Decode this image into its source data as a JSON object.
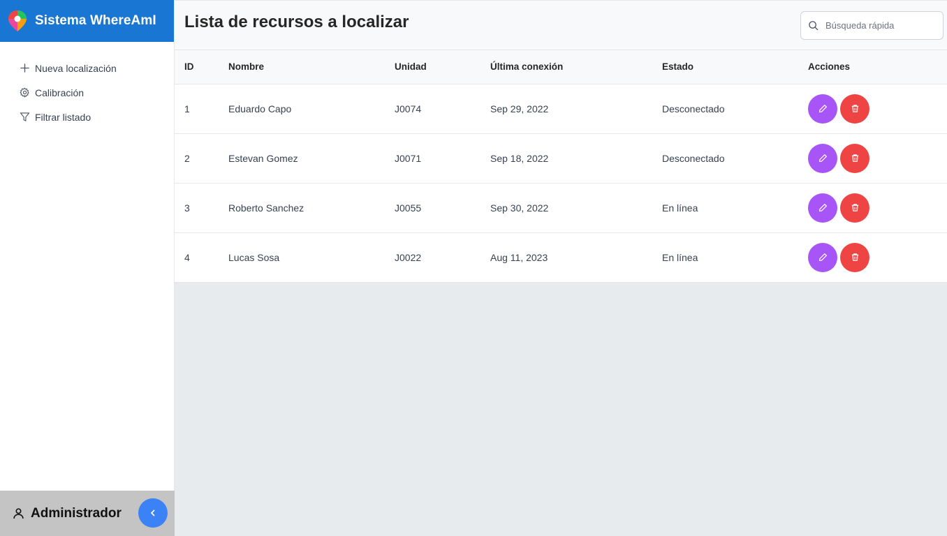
{
  "app": {
    "title": "Sistema WhereAmI"
  },
  "sidebar": {
    "items": [
      {
        "label": "Nueva localización",
        "icon": "plus-icon"
      },
      {
        "label": "Calibración",
        "icon": "gear-icon"
      },
      {
        "label": "Filtrar listado",
        "icon": "filter-icon"
      }
    ],
    "user": {
      "name": "Administrador",
      "icon": "user-icon"
    }
  },
  "header": {
    "title": "Lista de recursos a localizar",
    "search_placeholder": "Búsqueda rápida"
  },
  "table": {
    "columns": [
      "ID",
      "Nombre",
      "Unidad",
      "Última conexión",
      "Estado",
      "Acciones"
    ],
    "rows": [
      {
        "id": "1",
        "name": "Eduardo Capo",
        "unit": "J0074",
        "last": "Sep 29, 2022",
        "state": "Desconectado"
      },
      {
        "id": "2",
        "name": "Estevan Gomez",
        "unit": "J0071",
        "last": "Sep 18, 2022",
        "state": "Desconectado"
      },
      {
        "id": "3",
        "name": "Roberto Sanchez",
        "unit": "J0055",
        "last": "Sep 30, 2022",
        "state": "En línea"
      },
      {
        "id": "4",
        "name": "Lucas Sosa",
        "unit": "J0022",
        "last": "Aug 11, 2023",
        "state": "En línea"
      }
    ]
  },
  "colors": {
    "brand": "#1976d2",
    "edit": "#a855f7",
    "delete": "#ef4444",
    "collapse": "#3b82f6"
  }
}
